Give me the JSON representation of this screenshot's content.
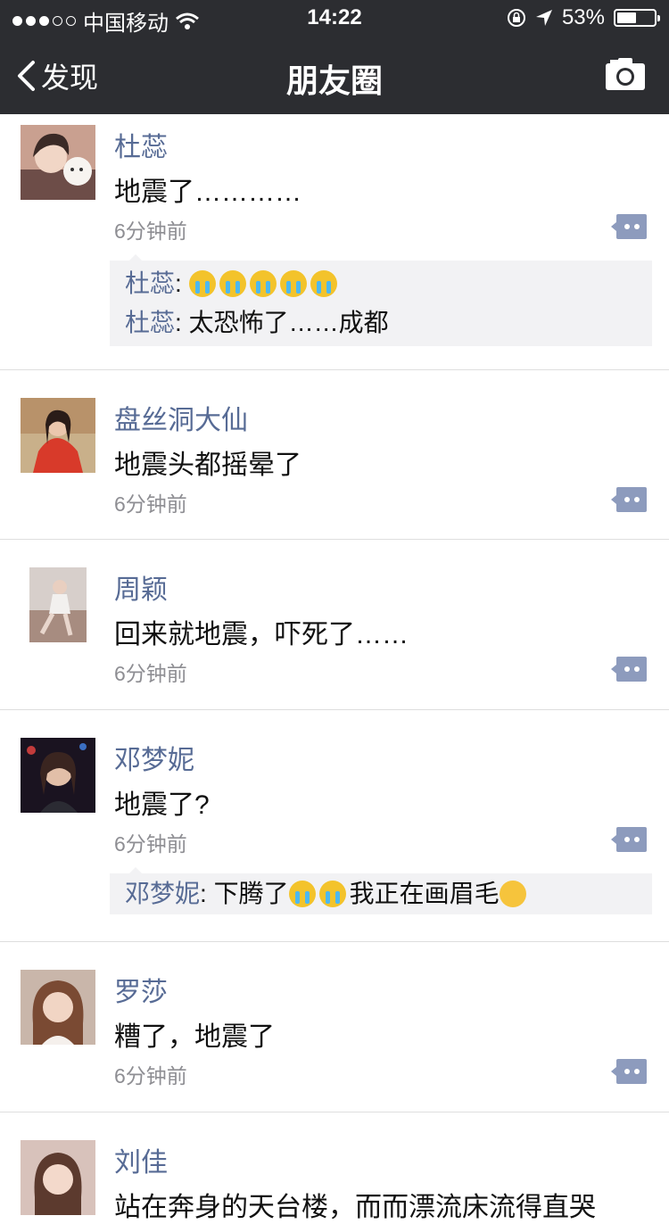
{
  "status_bar": {
    "carrier": "中国移动",
    "time": "14:22",
    "battery": "53%",
    "battery_level": 0.53
  },
  "nav": {
    "back_label": "发现",
    "title": "朋友圈"
  },
  "posts": [
    {
      "name": "杜蕊",
      "content": "地震了…………",
      "time": "6分钟前",
      "comments": [
        {
          "name": "杜蕊",
          "sep": ": ",
          "emoji": [
            "crying-emoji",
            "crying-emoji",
            "crying-emoji",
            "crying-emoji",
            "crying-emoji"
          ],
          "text": ""
        },
        {
          "name": "杜蕊",
          "sep": ": ",
          "emoji": [],
          "text": "太恐怖了……成都"
        }
      ]
    },
    {
      "name": "盘丝洞大仙",
      "content": "地震头都摇晕了",
      "time": "6分钟前",
      "comments": []
    },
    {
      "name": "周颖",
      "content": "回来就地震，吓死了……",
      "time": "6分钟前",
      "comments": []
    },
    {
      "name": "邓梦妮",
      "content": "地震了?",
      "time": "6分钟前",
      "comments": [
        {
          "name": "邓梦妮",
          "sep": ": ",
          "text_before": "下腾了",
          "emoji_mid": [
            "crying-emoji",
            "crying-emoji"
          ],
          "text_after": "我正在画眉毛",
          "emoji_end": "laughing-emoji"
        }
      ]
    },
    {
      "name": "罗莎",
      "content": "糟了，地震了",
      "time": "6分钟前",
      "comments": []
    },
    {
      "name": "刘佳",
      "content": "站在奔身的天台楼，而而漂流床流得直哭",
      "time": "",
      "comments": []
    }
  ],
  "colors": {
    "nav_bg": "#2c2d31",
    "name": "#576b95",
    "comment_bg": "#f2f2f4"
  }
}
